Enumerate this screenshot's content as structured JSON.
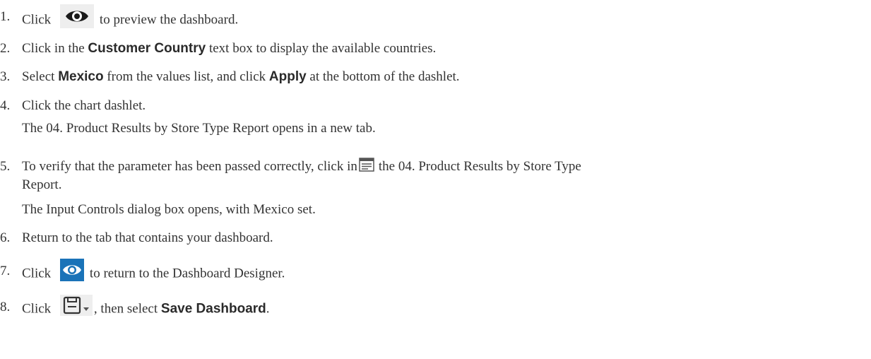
{
  "steps": [
    {
      "num": "1.",
      "pre": "Click",
      "post": "to preview the dashboard.",
      "icon": "eye-icon"
    },
    {
      "num": "2.",
      "pre": "Click in the",
      "bold": "Customer Country",
      "post": "text box to display the available countries."
    },
    {
      "num": "3.",
      "pre": "Select",
      "bold1": "Mexico",
      "mid": "from the values list, and click",
      "bold2": "Apply",
      "post": "at the bottom of the dashlet."
    },
    {
      "num": "4.",
      "text": "Click the chart dashlet.",
      "sub": "The 04. Product Results by Store Type Report opens in a new tab."
    },
    {
      "num": "5.",
      "pre": "To verify that the parameter has been passed correctly, click in",
      "post": "the 04. Product Results by Store Type",
      "cont": "Report.",
      "sub": "The Input Controls dialog box opens, with Mexico set.",
      "icon": "input-controls-icon"
    },
    {
      "num": "6.",
      "text": "Return to the tab that contains your dashboard."
    },
    {
      "num": "7.",
      "pre": "Click",
      "post": "to return to the Dashboard Designer.",
      "icon": "eye-icon"
    },
    {
      "num": "8.",
      "pre": "Click",
      "mid": ", then select",
      "bold": "Save Dashboard",
      "post": ".",
      "icon": "save-icon"
    }
  ],
  "colors": {
    "text": "#333333",
    "accent_blue": "#1a73b8",
    "icon_grey_bg": "#eeeeee"
  }
}
